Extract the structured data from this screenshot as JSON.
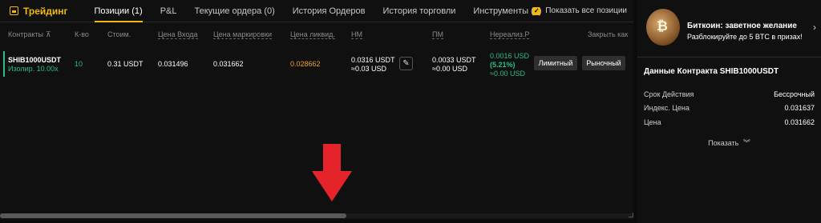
{
  "tabs": {
    "brand": "Трейдинг",
    "items": [
      "Позиции (1)",
      "P&L",
      "Текущие ордера (0)",
      "История Ордеров",
      "История торговли",
      "Инструменты (0)"
    ],
    "show_all": "Показать все позиции"
  },
  "table": {
    "headers": {
      "contracts": "Контракты",
      "qty": "К-во",
      "value": "Стоим.",
      "entry": "Цена Входа",
      "mark": "Цена маркировки",
      "liq": "Цена ликвид.",
      "im": "НМ",
      "mm": "ПМ",
      "pnl": "Нереализ.Р",
      "close": "Закрыть как"
    },
    "row": {
      "symbol": "SHIB1000USDT",
      "leverage": "Изолир. 10.00x",
      "qty": "10",
      "value": "0.31 USDT",
      "entry": "0.031496",
      "mark": "0.031662",
      "liq": "0.028662",
      "im_main": "0.0316 USDT",
      "im_sub": "≈0.03 USD",
      "mm_main": "0.0033 USDT",
      "mm_sub": "≈0.00 USD",
      "pnl_main": "0.0016 USD",
      "pnl_pct": "(5.21%)",
      "pnl_sub": "≈0.00 USD",
      "btn_limit": "Лимитный",
      "btn_market": "Рыночный"
    }
  },
  "promo": {
    "title": "Биткоин: заветное желание",
    "subtitle": "Разблокируйте до 5 BTC в призах!"
  },
  "contract": {
    "title": "Данные Контракта SHIB1000USDT",
    "rows": [
      {
        "label": "Срок Действия",
        "value": "Бессрочный"
      },
      {
        "label": "Индекс. Цена",
        "value": "0.031637"
      },
      {
        "label": "Цена",
        "value": "0.031662"
      }
    ],
    "show_more": "Показать"
  },
  "colors": {
    "accent": "#f0b90b",
    "profit": "#2ebd85",
    "liq": "#f0a62a",
    "arrow": "#e5232b"
  },
  "icons": [
    "trading-icon",
    "checkbox-checked-icon",
    "pin-icon",
    "edit-icon",
    "chevron-right-icon",
    "chevron-down-double-icon",
    "down-arrow-icon"
  ]
}
